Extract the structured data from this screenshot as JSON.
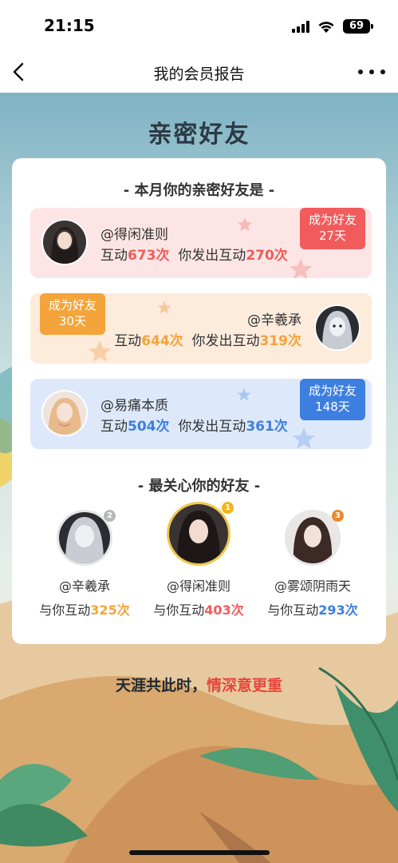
{
  "status_bar": {
    "time": "21:15",
    "battery": "69"
  },
  "nav": {
    "title": "我的会员报告",
    "back_icon": "chevron-left-icon",
    "more_icon": "ellipsis-icon"
  },
  "hero": {
    "title": "亲密好友"
  },
  "close_friends": {
    "heading": "- 本月你的亲密好友是 -",
    "items": [
      {
        "name": "@得闲准则",
        "interact_label": "互动",
        "interact_count": "673次",
        "sent_label": "你发出互动",
        "sent_count": "270次",
        "badge_line1": "成为好友",
        "badge_line2": "27天",
        "accent": "#f25b5b"
      },
      {
        "name": "@辛羲承",
        "interact_label": "互动",
        "interact_count": "644次",
        "sent_label": "你发出互动",
        "sent_count": "319次",
        "badge_line1": "成为好友",
        "badge_line2": "30天",
        "accent": "#f4a43a"
      },
      {
        "name": "@易痛本质",
        "interact_label": "互动",
        "interact_count": "504次",
        "sent_label": "你发出互动",
        "sent_count": "361次",
        "badge_line1": "成为好友",
        "badge_line2": "148天",
        "accent": "#3d7fe0"
      }
    ]
  },
  "caring_friends": {
    "heading": "- 最关心你的好友 -",
    "items": [
      {
        "rank": "2",
        "name": "@辛羲承",
        "label": "与你互动",
        "count": "325次",
        "accent": "#f4a43a"
      },
      {
        "rank": "1",
        "name": "@得闲准则",
        "label": "与你互动",
        "count": "403次",
        "accent": "#f25b5b"
      },
      {
        "rank": "3",
        "name": "@雾颂阴雨天",
        "label": "与你互动",
        "count": "293次",
        "accent": "#3d7fe0"
      }
    ]
  },
  "slogan": {
    "part1": "天涯共此时，",
    "part2": "情深意更重"
  },
  "colors": {
    "sky": "#7fb3c4",
    "card": "#ffffff",
    "red": "#f25b5b",
    "orange": "#f4a43a",
    "blue": "#3d7fe0"
  }
}
